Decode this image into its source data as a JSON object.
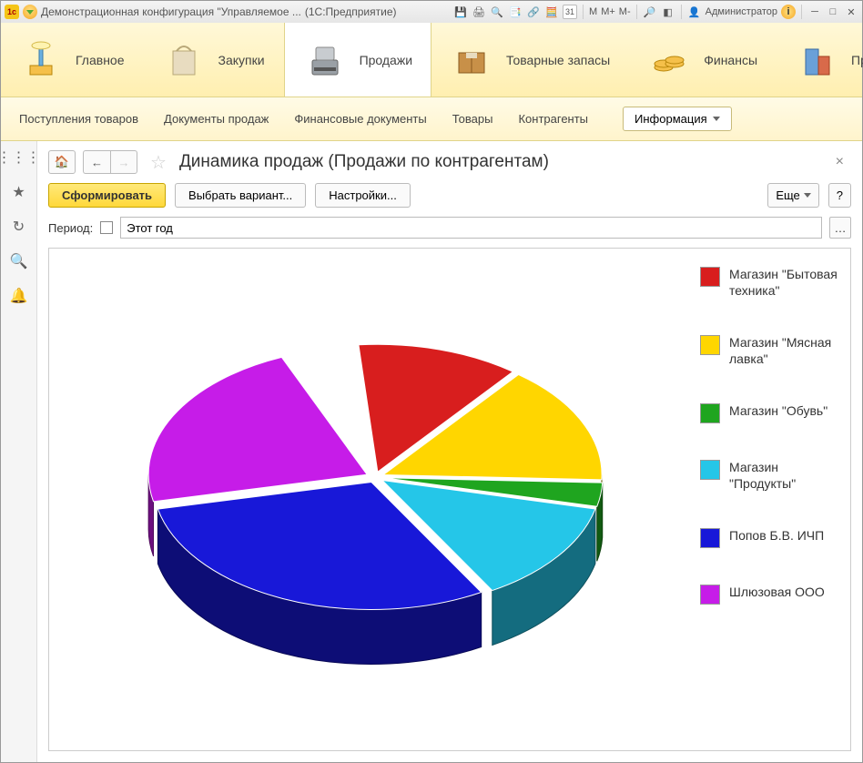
{
  "titlebar": {
    "app_title": "Демонстрационная конфигурация \"Управляемое ...",
    "platform": "(1С:Предприятие)",
    "user_label": "Администратор",
    "m_plain": "M",
    "m_plus": "M+",
    "m_minus": "M-",
    "calendar_day": "31"
  },
  "mainnav": {
    "items": [
      {
        "label": "Главное"
      },
      {
        "label": "Закупки"
      },
      {
        "label": "Продажи"
      },
      {
        "label": "Товарные запасы"
      },
      {
        "label": "Финансы"
      },
      {
        "label": "Предприят"
      }
    ]
  },
  "subnav": {
    "items": [
      "Поступления товаров",
      "Документы продаж",
      "Финансовые документы",
      "Товары",
      "Контрагенты"
    ],
    "info_label": "Информация"
  },
  "page": {
    "title": "Динамика продаж (Продажи по контрагентам)"
  },
  "toolbar": {
    "form_button": "Сформировать",
    "choose_variant": "Выбрать вариант...",
    "settings": "Настройки...",
    "more": "Еще",
    "help": "?"
  },
  "period": {
    "label": "Период:",
    "value": "Этот год"
  },
  "chart_data": {
    "type": "pie",
    "title": "",
    "series": [
      {
        "name": "Магазин \"Бытовая техника\"",
        "value": 12,
        "color": "#d81e1e"
      },
      {
        "name": "Магазин \"Мясная лавка\"",
        "value": 15,
        "color": "#ffd600"
      },
      {
        "name": "Магазин \"Обувь\"",
        "value": 3,
        "color": "#1fa51f"
      },
      {
        "name": "Магазин \"Продукты\"",
        "value": 13,
        "color": "#25c6e8"
      },
      {
        "name": "Попов Б.В. ИЧП",
        "value": 30,
        "color": "#1818d8"
      },
      {
        "name": "Шлюзовая ООО",
        "value": 22,
        "color": "#c61ce8"
      }
    ],
    "exploded_gap_after_index": 5
  }
}
